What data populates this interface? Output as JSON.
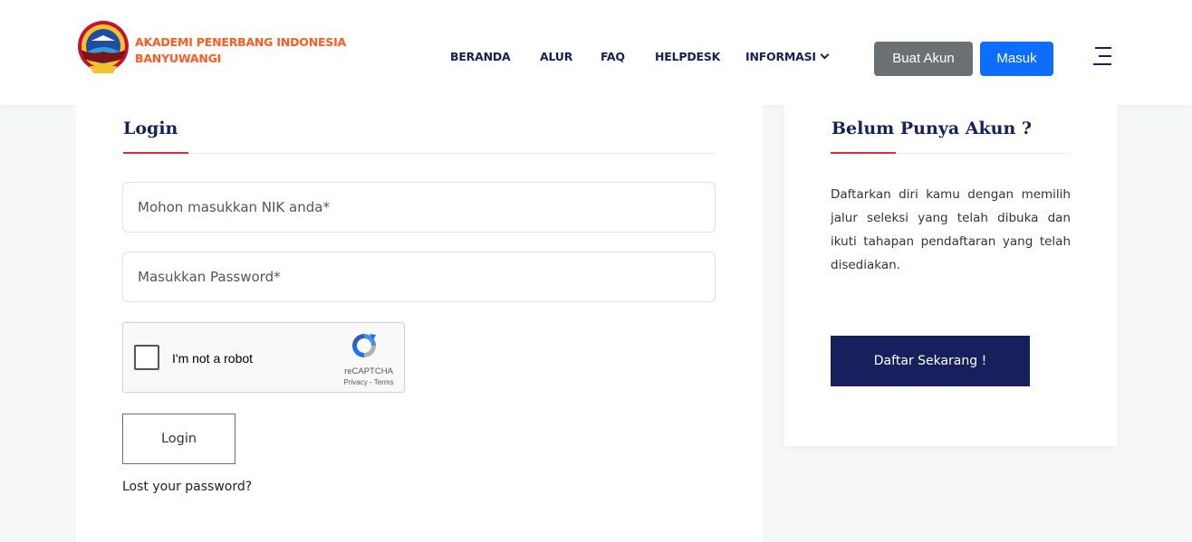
{
  "header": {
    "brand_line1": "AKADEMI PENERBANG INDONESIA",
    "brand_line2": "BANYUWANGI",
    "nav": {
      "beranda": "BERANDA",
      "alur": "ALUR",
      "faq": "FAQ",
      "helpdesk": "HELPDESK",
      "informasi": "INFORMASI"
    },
    "buat_akun": "Buat Akun",
    "masuk": "Masuk"
  },
  "login": {
    "title": "Login",
    "nik_placeholder": "Mohon masukkan NIK anda*",
    "password_placeholder": "Masukkan Password*",
    "recaptcha_label": "I'm not a robot",
    "recaptcha_brand": "reCAPTCHA",
    "recaptcha_terms": "Privacy - Terms",
    "button": "Login",
    "lost_password": "Lost your password?"
  },
  "sidebar": {
    "title": "Belum Punya Akun ?",
    "text": "Daftarkan diri kamu dengan memilih jalur seleksi yang telah dibuka dan ikuti tahapan pendaftaran yang telah disediakan.",
    "button": "Daftar Sekarang !"
  },
  "colors": {
    "navy": "#15205c",
    "brand_orange": "#ff5a1f",
    "accent_red": "#e02b3c",
    "primary_blue": "#0d6efd",
    "secondary_gray": "#6b7075"
  }
}
